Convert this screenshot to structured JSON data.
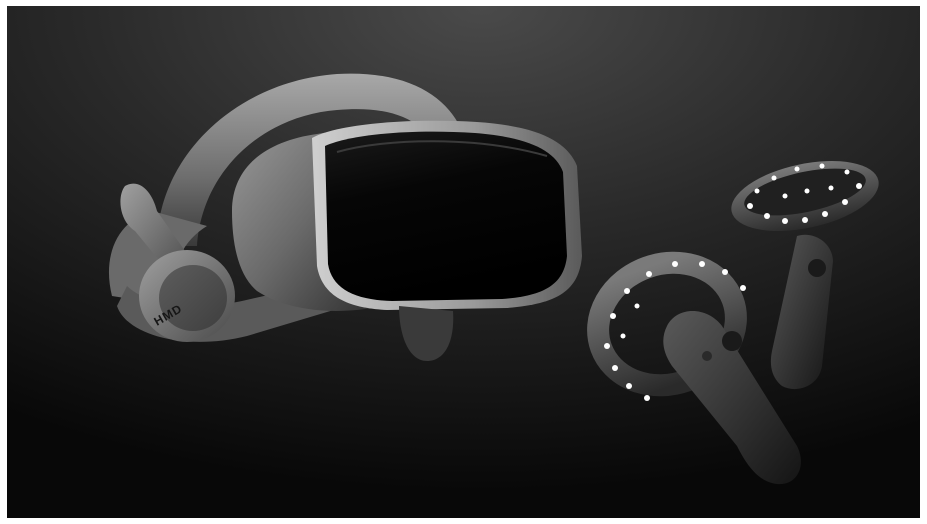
{
  "image": {
    "subject": "vr-headset-and-motion-controllers",
    "colors": {
      "background_light": "#3a3a3a",
      "background_dark": "#050505",
      "shell": "#8a8a8a",
      "visor": "#050505",
      "led": "#ffffff"
    }
  },
  "headset": {
    "logo_text": "HMD"
  }
}
